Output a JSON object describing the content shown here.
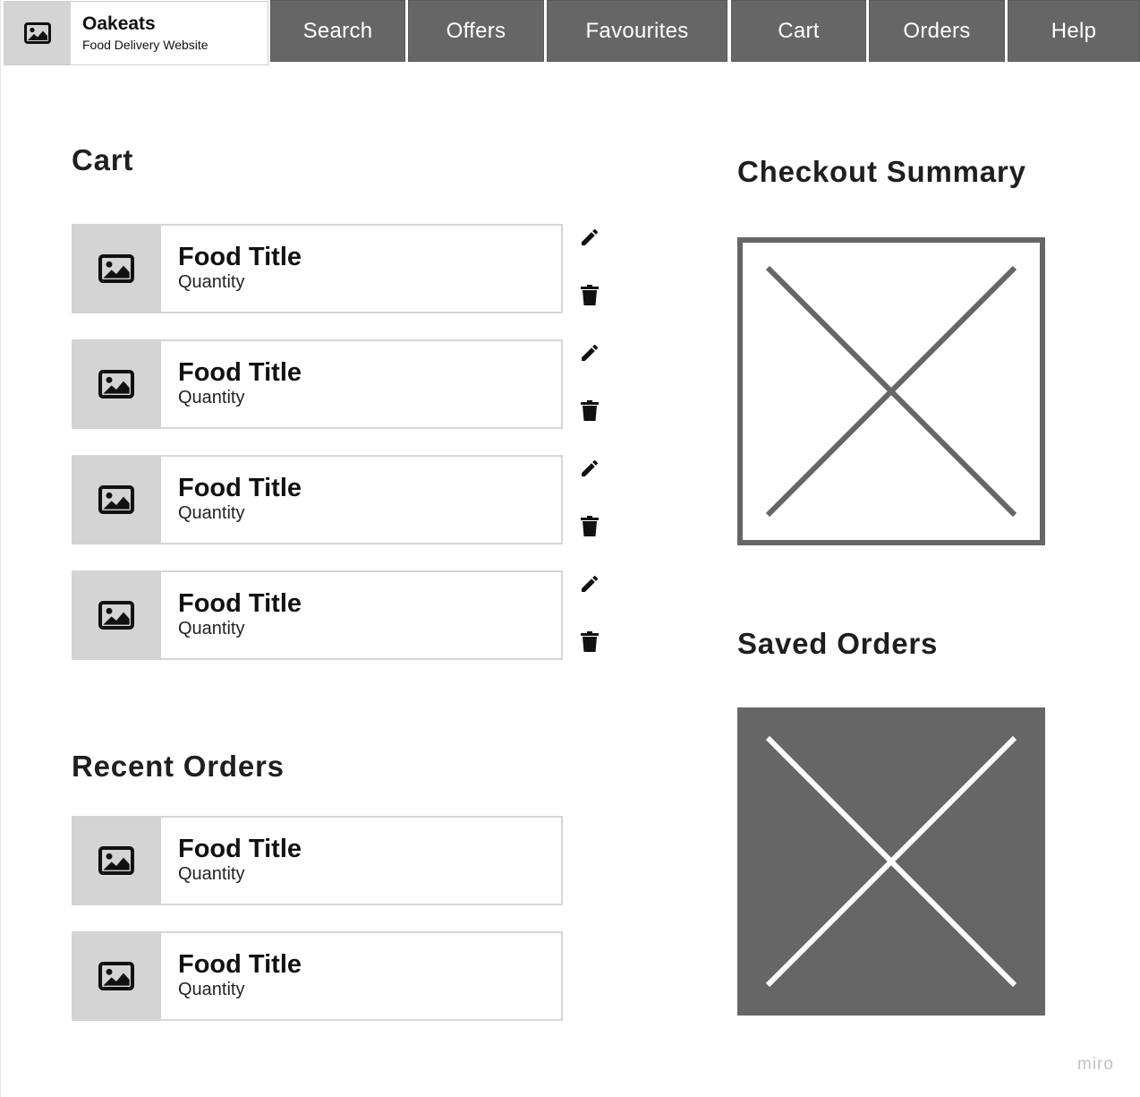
{
  "brand": {
    "name": "Oakeats",
    "subtitle": "Food Delivery Website",
    "logo_icon": "image-icon"
  },
  "nav": {
    "tabs": [
      {
        "label": "Search"
      },
      {
        "label": "Offers"
      },
      {
        "label": "Favourites"
      },
      {
        "label": "Cart"
      },
      {
        "label": "Orders"
      },
      {
        "label": "Help"
      }
    ]
  },
  "cart": {
    "heading": "Cart",
    "items": [
      {
        "title": "Food Title",
        "quantity": "Quantity"
      },
      {
        "title": "Food Title",
        "quantity": "Quantity"
      },
      {
        "title": "Food Title",
        "quantity": "Quantity"
      },
      {
        "title": "Food Title",
        "quantity": "Quantity"
      }
    ],
    "item_actions": {
      "edit_icon": "pencil-icon",
      "delete_icon": "trash-icon"
    }
  },
  "recent_orders": {
    "heading": "Recent Orders",
    "items": [
      {
        "title": "Food Title",
        "quantity": "Quantity"
      },
      {
        "title": "Food Title",
        "quantity": "Quantity"
      }
    ]
  },
  "checkout_summary": {
    "heading": "Checkout Summary"
  },
  "saved_orders": {
    "heading": "Saved Orders"
  },
  "watermark": "miro",
  "colors": {
    "nav_bg": "#666666",
    "thumb_bg": "#d4d4d4",
    "card_border": "#d6d6d6",
    "placeholder_dark": "#666666"
  }
}
